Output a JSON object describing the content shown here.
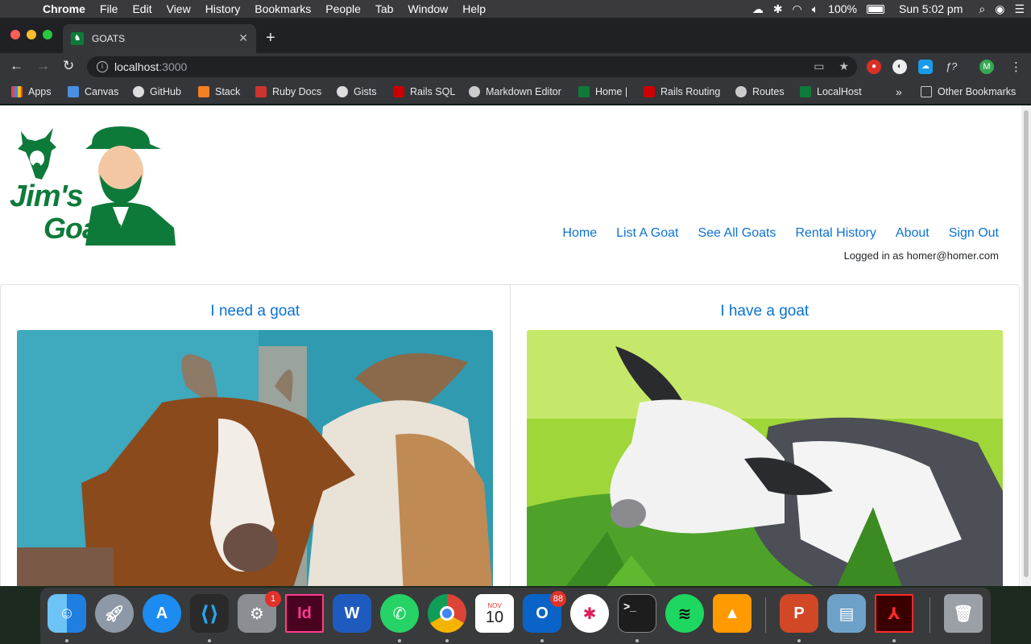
{
  "menubar": {
    "app_name": "Chrome",
    "items": [
      "File",
      "Edit",
      "View",
      "History",
      "Bookmarks",
      "People",
      "Tab",
      "Window",
      "Help"
    ],
    "battery": "100%",
    "clock": "Sun 5:02 pm"
  },
  "browser": {
    "tab_title": "GOATS",
    "url_host": "localhost",
    "url_port": ":3000",
    "profile_initial": "M",
    "bookmarks": [
      "Apps",
      "Canvas",
      "GitHub",
      "Stack",
      "Ruby Docs",
      "Gists",
      "Rails SQL",
      "Markdown Editor",
      "Home |",
      "Rails Routing",
      "Routes",
      "LocalHost"
    ],
    "other_bookmarks": "Other Bookmarks",
    "overflow": "»"
  },
  "site": {
    "logo_line1": "Jim's",
    "logo_line2": "Goats",
    "nav": [
      "Home",
      "List A Goat",
      "See All Goats",
      "Rental History",
      "About",
      "Sign Out"
    ],
    "logged_in": "Logged in as homer@homer.com",
    "cards": [
      {
        "title": "I need a goat"
      },
      {
        "title": "I have a goat"
      }
    ]
  },
  "dock": {
    "system_prefs_badge": "1",
    "indesign_label": "Id",
    "word_label": "W",
    "calendar_month": "NOV",
    "calendar_day": "10",
    "outlook_label": "O",
    "outlook_badge": "88",
    "powerpoint_label": "P"
  },
  "colors": {
    "link": "#0b72d6",
    "logo_green": "#0e7a3a",
    "browser_dark": "#202124"
  }
}
